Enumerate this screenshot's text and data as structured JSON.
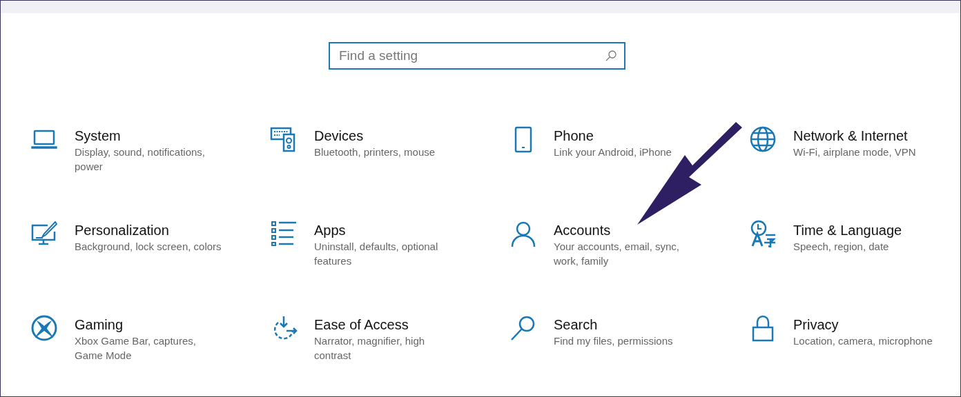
{
  "search": {
    "placeholder": "Find a setting",
    "focused": true
  },
  "categories": [
    {
      "title": "System",
      "description": "Display, sound, notifications, power"
    },
    {
      "title": "Devices",
      "description": "Bluetooth, printers, mouse"
    },
    {
      "title": "Phone",
      "description": "Link your Android, iPhone"
    },
    {
      "title": "Network & Internet",
      "description": "Wi-Fi, airplane mode, VPN"
    },
    {
      "title": "Personalization",
      "description": "Background, lock screen, colors"
    },
    {
      "title": "Apps",
      "description": "Uninstall, defaults, optional features"
    },
    {
      "title": "Accounts",
      "description": "Your accounts, email, sync, work, family"
    },
    {
      "title": "Time & Language",
      "description": "Speech, region, date"
    },
    {
      "title": "Gaming",
      "description": "Xbox Game Bar, captures, Game Mode"
    },
    {
      "title": "Ease of Access",
      "description": "Narrator, magnifier, high contrast"
    },
    {
      "title": "Search",
      "description": "Find my files, permissions"
    },
    {
      "title": "Privacy",
      "description": "Location, camera, microphone"
    }
  ],
  "annotation": {
    "kind": "arrow"
  }
}
